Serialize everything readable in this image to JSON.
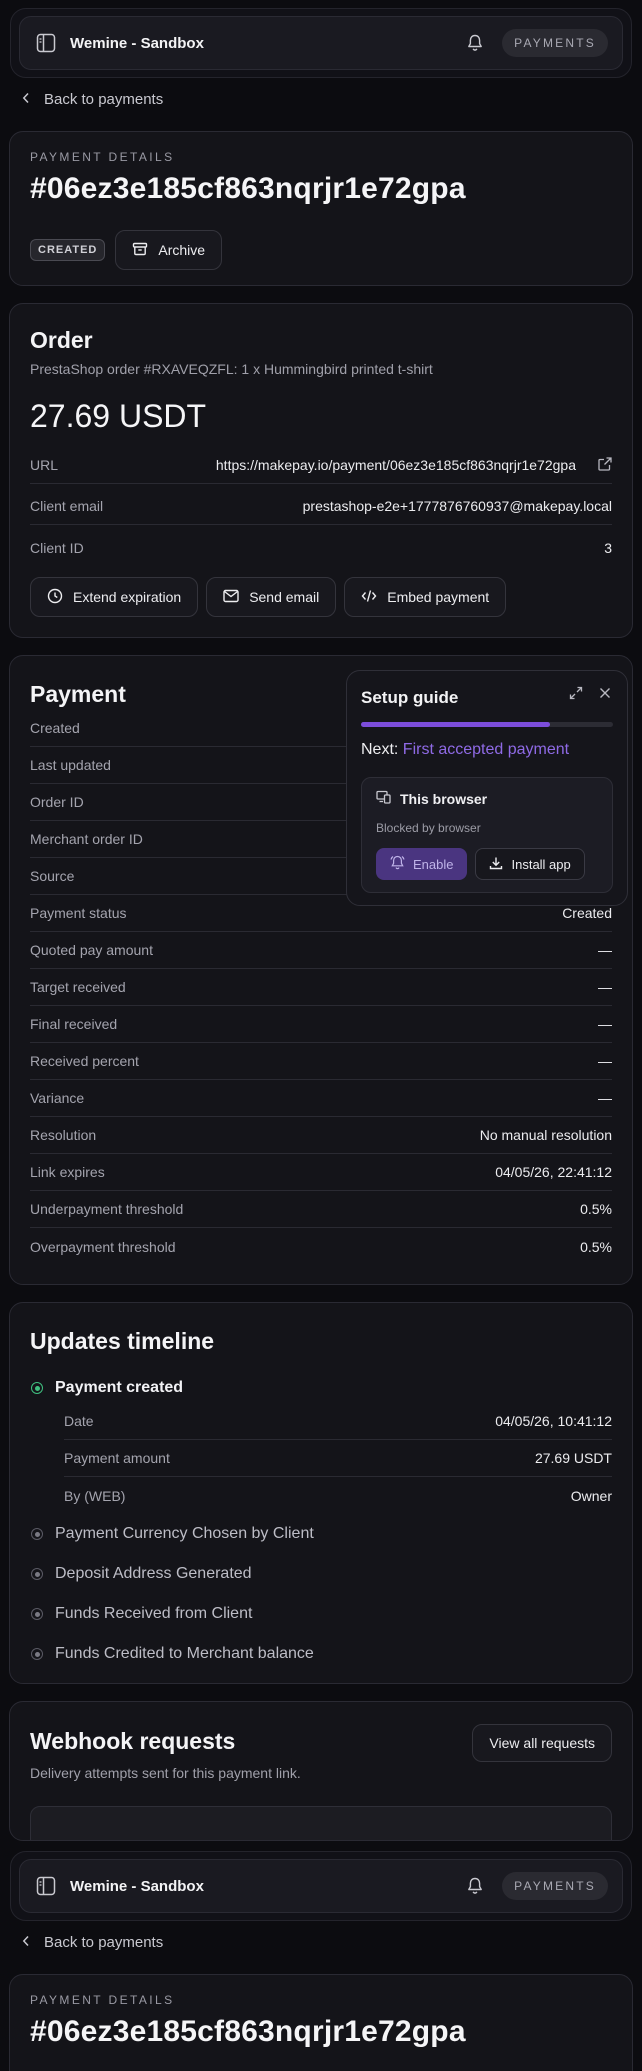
{
  "header": {
    "app_title": "Wemine - Sandbox",
    "section_pill": "PAYMENTS"
  },
  "nav": {
    "back_label": "Back to payments"
  },
  "details": {
    "overline": "PAYMENT DETAILS",
    "payment_id": "#06ez3e185cf863nqrjr1e72gpa",
    "status_badge": "CREATED",
    "archive_label": "Archive"
  },
  "order": {
    "title": "Order",
    "description": "PrestaShop order #RXAVEQZFL: 1 x Hummingbird printed t-shirt",
    "amount": "27.69 USDT",
    "rows": [
      {
        "label": "URL",
        "value": "https://makepay.io/payment/06ez3e185cf863nqrjr1e72gpa"
      },
      {
        "label": "Client email",
        "value": "prestashop-e2e+1777876760937@makepay.local"
      },
      {
        "label": "Client ID",
        "value": "3"
      }
    ],
    "actions": {
      "extend": "Extend expiration",
      "send_email": "Send email",
      "embed": "Embed payment"
    }
  },
  "payment": {
    "title": "Payment",
    "rows": [
      {
        "label": "Created",
        "value": ""
      },
      {
        "label": "Last updated",
        "value": ""
      },
      {
        "label": "Order ID",
        "value": ""
      },
      {
        "label": "Merchant order ID",
        "value": ""
      },
      {
        "label": "Source",
        "value": ""
      },
      {
        "label": "Payment status",
        "value": "Created"
      },
      {
        "label": "Quoted pay amount",
        "value": "—"
      },
      {
        "label": "Target received",
        "value": "—"
      },
      {
        "label": "Final received",
        "value": "—"
      },
      {
        "label": "Received percent",
        "value": "—"
      },
      {
        "label": "Variance",
        "value": "—"
      },
      {
        "label": "Resolution",
        "value": "No manual resolution"
      },
      {
        "label": "Link expires",
        "value": "04/05/26, 22:41:12"
      },
      {
        "label": "Underpayment threshold",
        "value": "0.5%"
      },
      {
        "label": "Overpayment threshold",
        "value": "0.5%"
      }
    ]
  },
  "setup_guide": {
    "title": "Setup guide",
    "progress": 0.75,
    "next_prefix": "Next:",
    "next_step": "First accepted payment",
    "box_title": "This browser",
    "box_status": "Blocked by browser",
    "enable_label": "Enable",
    "install_label": "Install app"
  },
  "timeline": {
    "title": "Updates timeline",
    "created": {
      "label": "Payment created",
      "rows": [
        {
          "label": "Date",
          "value": "04/05/26, 10:41:12"
        },
        {
          "label": "Payment amount",
          "value": "27.69 USDT"
        },
        {
          "label": "By (WEB)",
          "value": "Owner"
        }
      ]
    },
    "pending": [
      "Payment Currency Chosen by Client",
      "Deposit Address Generated",
      "Funds Received from Client",
      "Funds Credited to Merchant balance"
    ]
  },
  "webhooks": {
    "title": "Webhook requests",
    "subtitle": "Delivery attempts sent for this payment link.",
    "view_all": "View all requests"
  },
  "colors": {
    "accent": "#7c4ddb",
    "success": "#3fbf7f",
    "background": "#0c0c10"
  }
}
